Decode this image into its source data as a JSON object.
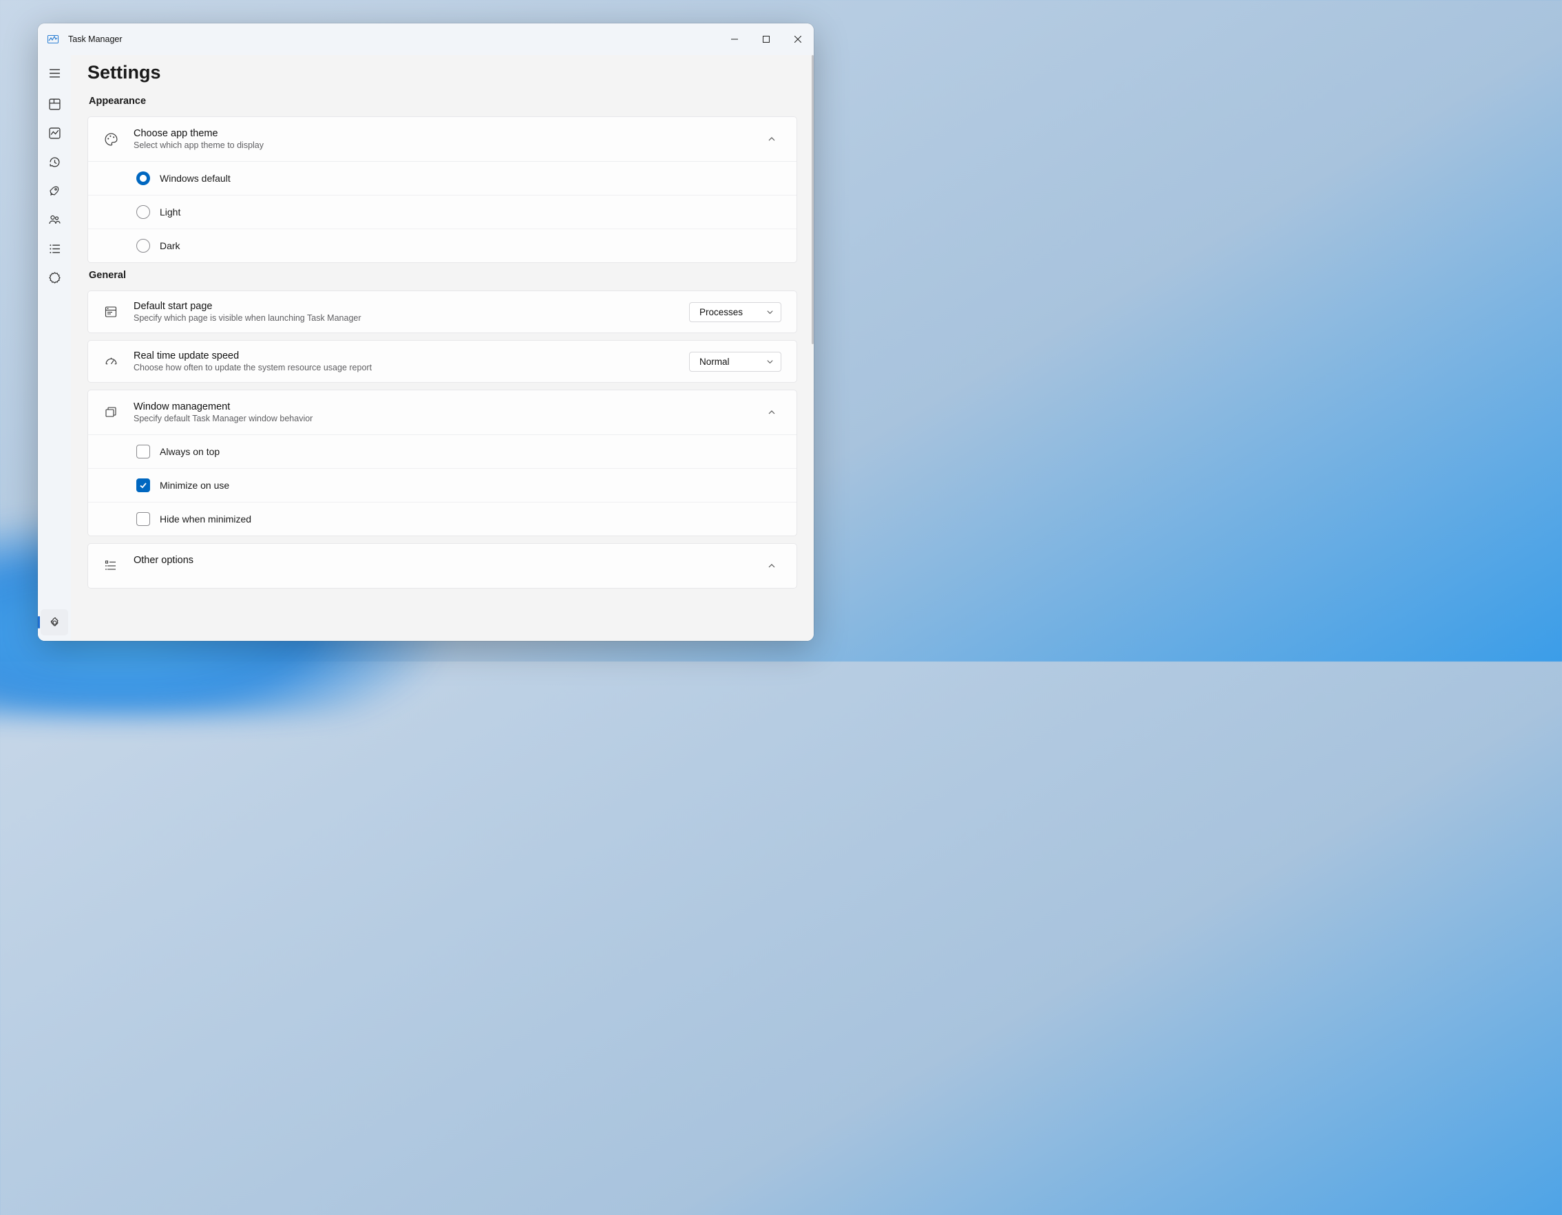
{
  "window": {
    "title": "Task Manager"
  },
  "page": {
    "title": "Settings"
  },
  "sections": {
    "appearance": {
      "heading": "Appearance",
      "theme": {
        "title": "Choose app theme",
        "subtitle": "Select which app theme to display",
        "options": {
          "windows_default": "Windows default",
          "light": "Light",
          "dark": "Dark"
        },
        "selected": "windows_default"
      }
    },
    "general": {
      "heading": "General",
      "start_page": {
        "title": "Default start page",
        "subtitle": "Specify which page is visible when launching Task Manager",
        "value": "Processes"
      },
      "update_speed": {
        "title": "Real time update speed",
        "subtitle": "Choose how often to update the system resource usage report",
        "value": "Normal"
      },
      "window_mgmt": {
        "title": "Window management",
        "subtitle": "Specify default Task Manager window behavior",
        "options": {
          "always_on_top": {
            "label": "Always on top",
            "checked": false
          },
          "minimize_on_use": {
            "label": "Minimize on use",
            "checked": true
          },
          "hide_when_minimized": {
            "label": "Hide when minimized",
            "checked": false
          }
        }
      },
      "other": {
        "title": "Other options"
      }
    }
  }
}
